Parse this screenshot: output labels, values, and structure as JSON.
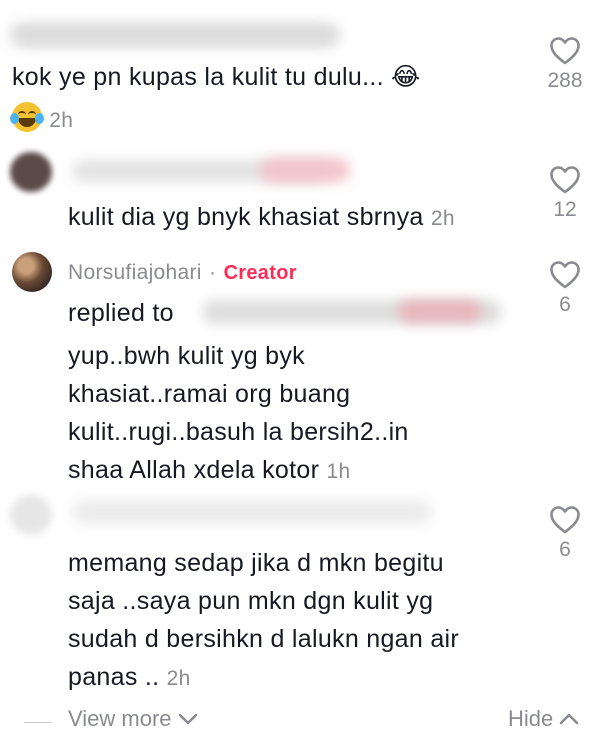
{
  "comments": [
    {
      "text": "kok ye pn kupas la kulit tu dulu... 😂",
      "time": "2h",
      "likes": "288",
      "emoji_icon": "joy-emoji"
    },
    {
      "text": "kulit dia yg bnyk khasiat sbrnya",
      "time": "2h",
      "likes": "12"
    },
    {
      "username": "Norsufiajohari",
      "separator": "·",
      "badge": "Creator",
      "replied_to": "replied to",
      "lines": [
        "yup..bwh kulit yg byk",
        "khasiat..ramai org buang",
        "kulit..rugi..basuh la bersih2..in",
        "shaa Allah xdela kotor"
      ],
      "time": "1h",
      "likes": "6"
    },
    {
      "lines": [
        "memang sedap jika d mkn begitu",
        "saja ..saya pun mkn dgn kulit yg",
        "sudah d bersihkn d lalukn ngan air",
        "panas .."
      ],
      "time": "2h",
      "likes": "6"
    }
  ],
  "footer": {
    "view_more": "View more",
    "hide": "Hide"
  },
  "colors": {
    "text": "#161823",
    "muted": "#8a8b91",
    "creator": "#fe2c55"
  },
  "icons": [
    "heart-outline-icon",
    "chevron-down-icon",
    "chevron-up-icon"
  ]
}
